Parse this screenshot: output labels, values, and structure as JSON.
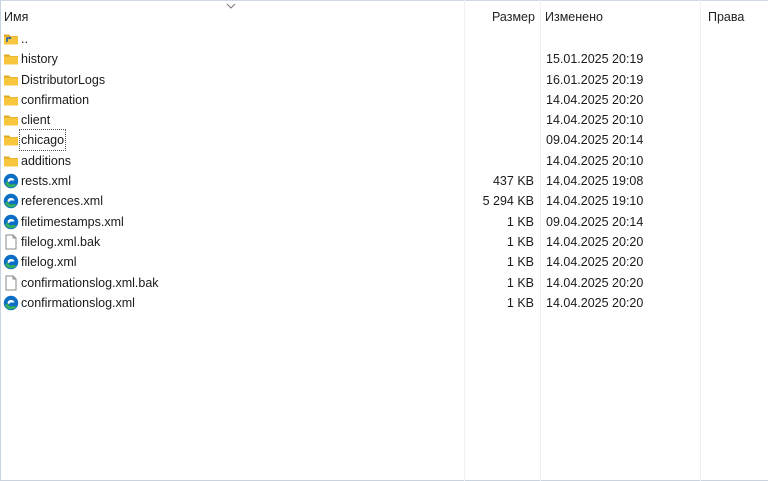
{
  "columns": {
    "name": "Имя",
    "size": "Размер",
    "modified": "Изменено",
    "rights": "Права"
  },
  "rows": [
    {
      "name": "..",
      "size": "",
      "modified": "",
      "icon": "parent-folder-icon"
    },
    {
      "name": "history",
      "size": "",
      "modified": "15.01.2025 20:19",
      "icon": "folder-icon"
    },
    {
      "name": "DistributorLogs",
      "size": "",
      "modified": "16.01.2025 20:19",
      "icon": "folder-icon"
    },
    {
      "name": "confirmation",
      "size": "",
      "modified": "14.04.2025 20:20",
      "icon": "folder-icon"
    },
    {
      "name": "client",
      "size": "",
      "modified": "14.04.2025 20:10",
      "icon": "folder-icon"
    },
    {
      "name": "chicago",
      "size": "",
      "modified": "09.04.2025 20:14",
      "icon": "folder-icon"
    },
    {
      "name": "additions",
      "size": "",
      "modified": "14.04.2025 20:10",
      "icon": "folder-icon"
    },
    {
      "name": "rests.xml",
      "size": "437 KB",
      "modified": "14.04.2025 19:08",
      "icon": "edge-file-icon"
    },
    {
      "name": "references.xml",
      "size": "5 294 KB",
      "modified": "14.04.2025 19:10",
      "icon": "edge-file-icon"
    },
    {
      "name": "filetimestamps.xml",
      "size": "1 KB",
      "modified": "09.04.2025 20:14",
      "icon": "edge-file-icon"
    },
    {
      "name": "filelog.xml.bak",
      "size": "1 KB",
      "modified": "14.04.2025 20:20",
      "icon": "blank-file-icon"
    },
    {
      "name": "filelog.xml",
      "size": "1 KB",
      "modified": "14.04.2025 20:20",
      "icon": "edge-file-icon"
    },
    {
      "name": "confirmationslog.xml.bak",
      "size": "1 KB",
      "modified": "14.04.2025 20:20",
      "icon": "blank-file-icon"
    },
    {
      "name": "confirmationslog.xml",
      "size": "1 KB",
      "modified": "14.04.2025 20:20",
      "icon": "edge-file-icon"
    }
  ],
  "colors": {
    "folder": "#f7c63c",
    "edge_blue": "#0c6ec4",
    "edge_green": "#36b05a"
  }
}
